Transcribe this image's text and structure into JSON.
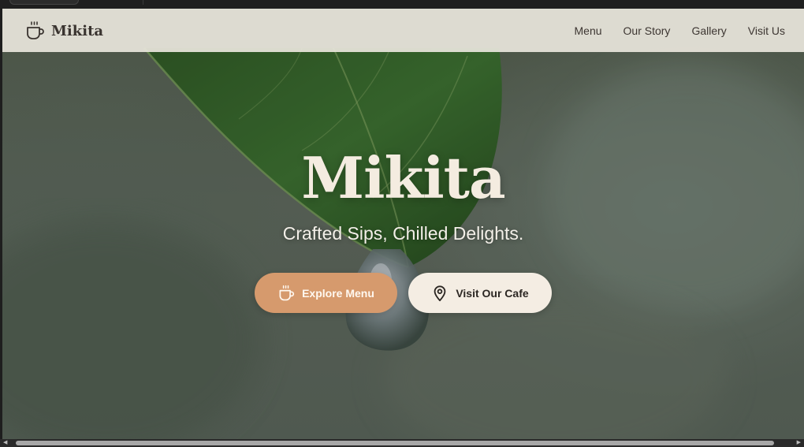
{
  "brand": {
    "name": "Mikita",
    "icon": "coffee-cup-icon"
  },
  "nav": {
    "links": [
      "Menu",
      "Our Story",
      "Gallery",
      "Visit Us"
    ]
  },
  "hero": {
    "title": "Mikita",
    "subtitle": "Crafted Sips, Chilled Delights.",
    "primary_button": {
      "label": "Explore Menu",
      "icon": "coffee-cup-icon"
    },
    "secondary_button": {
      "label": "Visit Our Cafe",
      "icon": "map-pin-icon"
    }
  },
  "colors": {
    "accent": "#d69a6d",
    "cream": "#f4ede3",
    "navbar": "#e8e5db",
    "text_dark": "#3a3430"
  }
}
